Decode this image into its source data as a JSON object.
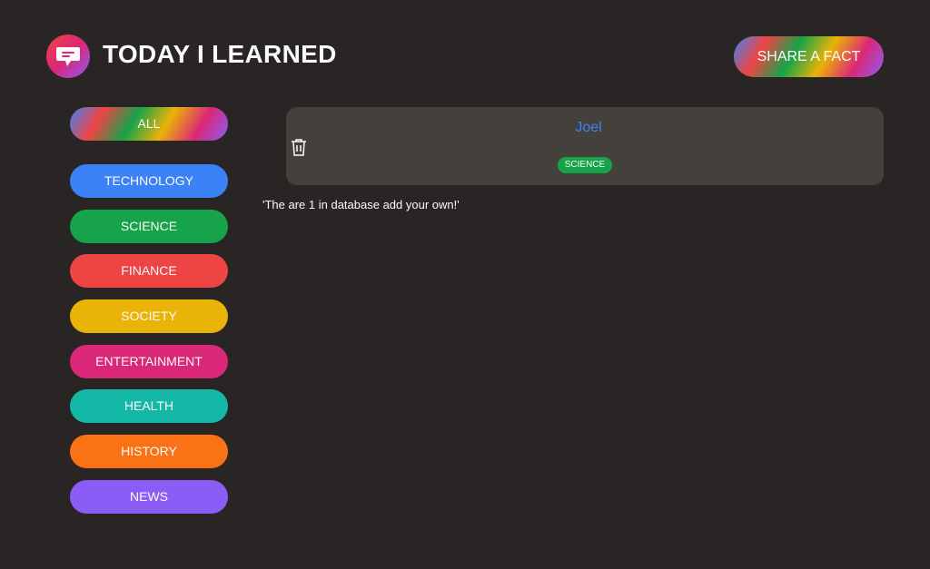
{
  "header": {
    "title": "TODAY I LEARNED",
    "logo_icon": "chat-bubble-icon",
    "share_label": "SHARE A FACT"
  },
  "sidebar": {
    "all_label": "ALL",
    "categories": [
      {
        "label": "TECHNOLOGY",
        "color": "#3b82f6"
      },
      {
        "label": "SCIENCE",
        "color": "#16a34a"
      },
      {
        "label": "FINANCE",
        "color": "#ef4444"
      },
      {
        "label": "SOCIETY",
        "color": "#eab308"
      },
      {
        "label": "ENTERTAINMENT",
        "color": "#db2777"
      },
      {
        "label": "HEALTH",
        "color": "#14b8a6"
      },
      {
        "label": "HISTORY",
        "color": "#f97316"
      },
      {
        "label": "NEWS",
        "color": "#8b5cf6"
      }
    ]
  },
  "facts": [
    {
      "author": "Joel",
      "category": "SCIENCE",
      "category_color": "#16a34a",
      "delete_icon": "trash-icon"
    }
  ],
  "status": {
    "message": "'The are 1 in database add your own!'"
  }
}
